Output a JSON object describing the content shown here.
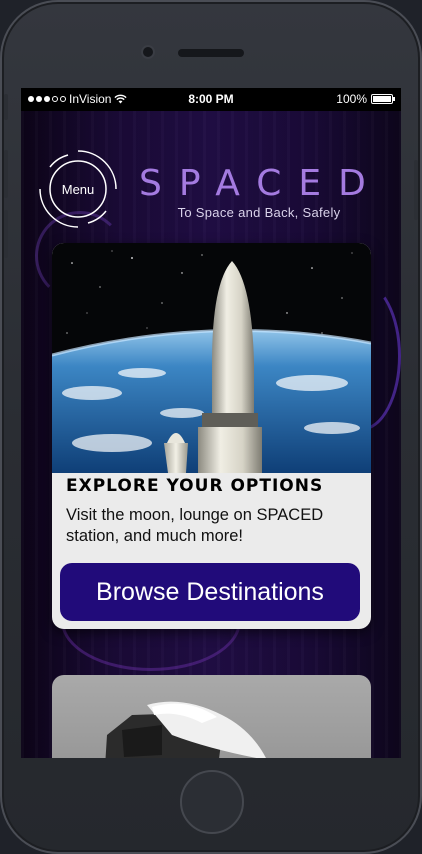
{
  "status_bar": {
    "carrier": "InVision",
    "time": "8:00 PM",
    "battery": "100%"
  },
  "header": {
    "menu_label": "Menu",
    "brand": "SPACED",
    "tagline": "To Space and Back, Safely"
  },
  "cards": [
    {
      "image": "rocket-over-earth",
      "title": "EXPLORE YOUR OPTIONS",
      "description": "Visit the moon, lounge on SPACED station, and much more!",
      "button_label": "Browse Destinations"
    },
    {
      "image": "spacecraft-capsule"
    }
  ],
  "colors": {
    "accent": "#a47be0",
    "button": "#210b7a",
    "card_bg": "#ebebeb",
    "background": "#1a0a36"
  }
}
